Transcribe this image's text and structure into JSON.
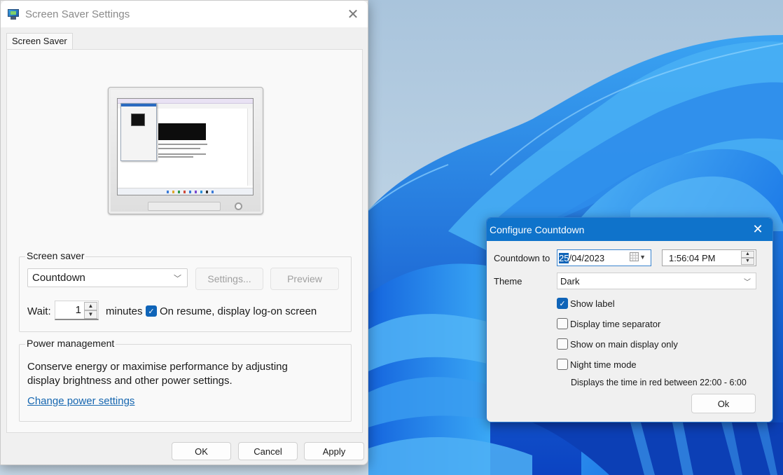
{
  "screen_saver_window": {
    "title": "Screen Saver Settings",
    "icons": {
      "app": "screen-saver-monitor-icon",
      "close": "close-icon"
    },
    "tabs": [
      {
        "label": "Screen Saver",
        "active": true
      }
    ],
    "screen_saver_group": {
      "legend": "Screen saver",
      "selected_saver": "Countdown",
      "settings_button": "Settings...",
      "preview_button": "Preview",
      "wait_label": "Wait:",
      "wait_value": "1",
      "minutes_label": "minutes",
      "on_resume_checked": true,
      "on_resume_label": "On resume, display log-on screen"
    },
    "power_group": {
      "legend": "Power management",
      "description": "Conserve energy or maximise performance by adjusting display brightness and other power settings.",
      "link": "Change power settings"
    },
    "footer": {
      "ok": "OK",
      "cancel": "Cancel",
      "apply": "Apply"
    }
  },
  "countdown_window": {
    "title": "Configure Countdown",
    "countdown_to_label": "Countdown to",
    "date": {
      "selected_part": "25",
      "rest": "/04/2023"
    },
    "time": "1:56:04 PM",
    "theme_label": "Theme",
    "theme_value": "Dark",
    "options": [
      {
        "label": "Show label",
        "checked": true
      },
      {
        "label": "Display time separator",
        "checked": false
      },
      {
        "label": "Show on main display only",
        "checked": false
      },
      {
        "label": "Night time mode",
        "checked": false
      }
    ],
    "note": "Displays the time in red between 22:00 - 6:00",
    "ok_button": "Ok"
  },
  "colors": {
    "accent": "#0f64b8",
    "countdown_titlebar": "#0f73cb",
    "link": "#1566b0",
    "disabled_text": "#a0a0a0"
  }
}
